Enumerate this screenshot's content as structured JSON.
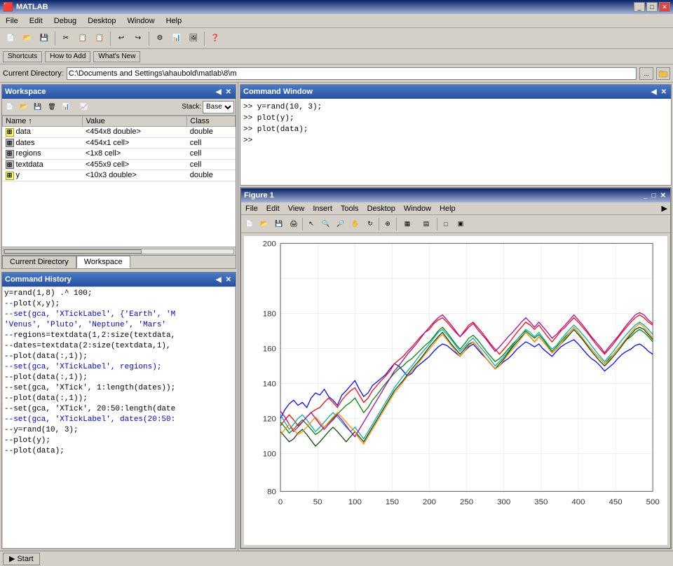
{
  "app": {
    "title": "MATLAB",
    "icon": "🟥"
  },
  "titlebar": {
    "title": "MATLAB",
    "minimize": "_",
    "maximize": "□",
    "close": "✕"
  },
  "menubar": {
    "items": [
      "File",
      "Edit",
      "Debug",
      "Desktop",
      "Window",
      "Help"
    ]
  },
  "toolbar": {
    "buttons": [
      "📁",
      "💾",
      "✂",
      "📋",
      "📋",
      "↩",
      "↪",
      "🔧",
      "📊",
      "📈",
      "❓"
    ]
  },
  "shortcutsbar": {
    "shortcuts": "Shortcuts",
    "how_to_add": "How to Add",
    "whats_new": "What's New"
  },
  "cdbar": {
    "label": "Current Directory:",
    "path": "C:\\Documents and Settings\\ahaubold\\matlab\\8\\m",
    "btn_browse": "...",
    "btn_go": "→"
  },
  "workspace": {
    "title": "Workspace",
    "columns": [
      "Name ↑",
      "Value",
      "Class"
    ],
    "rows": [
      {
        "icon": "double",
        "name": "data",
        "value": "<454x8 double>",
        "class": "double"
      },
      {
        "icon": "cell",
        "name": "dates",
        "value": "<454x1 cell>",
        "class": "cell"
      },
      {
        "icon": "cell",
        "name": "regions",
        "value": "<1x8 cell>",
        "class": "cell"
      },
      {
        "icon": "cell",
        "name": "textdata",
        "value": "<455x9 cell>",
        "class": "cell"
      },
      {
        "icon": "double",
        "name": "y",
        "value": "<10x3 double>",
        "class": "double"
      }
    ],
    "tab_current_directory": "Current Directory",
    "tab_workspace": "Workspace"
  },
  "command_history": {
    "title": "Command History",
    "lines": [
      {
        "text": "y=rand(1,8) .^ 100;",
        "type": "normal"
      },
      {
        "text": "--plot(x,y);",
        "type": "normal"
      },
      {
        "text": "--set(gca, 'XTickLabel', {'Earth', 'M",
        "type": "highlight"
      },
      {
        "text": "'Venus', 'Pluto', 'Neptune', 'Mars'",
        "type": "highlight"
      },
      {
        "text": "--regions=textdata(1,2:size(textdata,",
        "type": "normal"
      },
      {
        "text": "--dates=textdata(2:size(textdata,1),",
        "type": "normal"
      },
      {
        "text": "--plot(data(:,1));",
        "type": "normal"
      },
      {
        "text": "--set(gca, 'XTickLabel', regions);",
        "type": "highlight"
      },
      {
        "text": "--plot(data(:,1));",
        "type": "normal"
      },
      {
        "text": "--set(gca, 'XTick', 1:length(dates));",
        "type": "normal"
      },
      {
        "text": "--plot(data(:,1));",
        "type": "normal"
      },
      {
        "text": "--set(gca, 'XTick', 20:50:length(date",
        "type": "normal"
      },
      {
        "text": "--set(gca, 'XTickLabel', dates(20:50:",
        "type": "highlight"
      },
      {
        "text": "--y=rand(10, 3);",
        "type": "normal"
      },
      {
        "text": "--plot(y);",
        "type": "normal"
      },
      {
        "text": "--plot(data);",
        "type": "normal"
      }
    ]
  },
  "command_window": {
    "title": "Command Window",
    "lines": [
      ">>  y=rand(10, 3);",
      ">>  plot(y);",
      ">>  plot(data);",
      ">>"
    ]
  },
  "figure1": {
    "title": "Figure 1",
    "menubar": [
      "File",
      "Edit",
      "View",
      "Insert",
      "Tools",
      "Desktop",
      "Window",
      "Help"
    ],
    "plot": {
      "y_max": 200,
      "y_min": 80,
      "x_max": 500,
      "x_min": 0,
      "y_ticks": [
        80,
        100,
        120,
        140,
        160,
        180,
        200
      ],
      "x_ticks": [
        0,
        50,
        100,
        150,
        200,
        250,
        300,
        350,
        400,
        450,
        500
      ]
    }
  },
  "statusbar": {
    "start_label": "Start",
    "start_icon": "▶"
  }
}
